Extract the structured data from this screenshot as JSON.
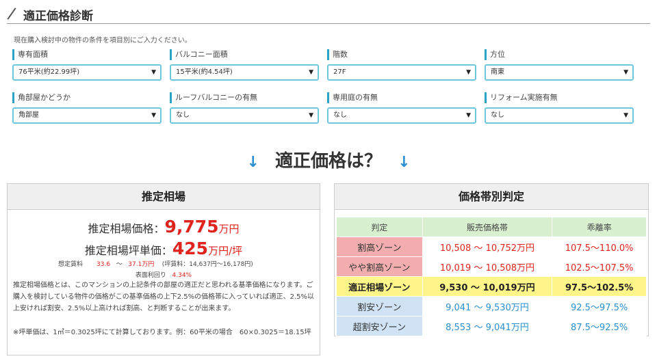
{
  "title": "適正価格診断",
  "intro": "現在購入検討中の物件の条件を項目別にご入力ください。",
  "fields": [
    {
      "label": "専有面積",
      "value": "76平米(約22.99坪)"
    },
    {
      "label": "バルコニー面積",
      "value": "15平米(約4.54坪)"
    },
    {
      "label": "階数",
      "value": "27F"
    },
    {
      "label": "方位",
      "value": "南東"
    },
    {
      "label": "角部屋かどうか",
      "value": "角部屋"
    },
    {
      "label": "ルーフバルコニーの有無",
      "value": "なし"
    },
    {
      "label": "専用庭の有無",
      "value": "なし"
    },
    {
      "label": "リフォーム実施有無",
      "value": "なし"
    }
  ],
  "question": "適正価格は？",
  "arrow": "↓",
  "caret": "▼",
  "estimate": {
    "heading": "推定相場",
    "price_label": "推定相場価格：",
    "price_value": "9,775",
    "price_unit": "万円",
    "tsubo_label": "推定相場坪単価：",
    "tsubo_value": "425",
    "tsubo_unit": "万円/坪",
    "rent_label": "想定賃料",
    "rent_min": "33.6",
    "rent_sep": "〜",
    "rent_max": "37.1万円",
    "rent_tsubo": "(坪賃料：14,637円〜16,178円)",
    "yield_label": "表面利回り",
    "yield_value": "4.34%",
    "description": "推定相場価格とは、このマンションの上記条件の部屋の適正だと思われる基準価格になります。ご購入を検討している物件の価格がこの基準価格の上下2.5%の価格帯に入っていれば適正、2.5%以上安ければ割安、2.5%以上高ければ割高、と判断することが出来ます。",
    "note": "※坪単価は、1㎡＝0.3025坪にて計算しております。例：60平米の場合　60×0.3025＝18.15坪"
  },
  "judge": {
    "heading": "価格帯別判定",
    "columns": [
      "判定",
      "販売価格帯",
      "乖離率"
    ],
    "rows": [
      {
        "zone": "割高ゾーン",
        "range": "10,508 〜 10,752万円",
        "rate": "107.5〜110.0%"
      },
      {
        "zone": "やや割高ゾーン",
        "range": "10,019 〜 10,508万円",
        "rate": "102.5〜107.5%"
      },
      {
        "zone": "適正相場ゾーン",
        "range": "9,530 〜 10,019万円",
        "rate": "97.5〜102.5%"
      },
      {
        "zone": "割安ゾーン",
        "range": "9,041 〜 9,530万円",
        "rate": "92.5〜97.5%"
      },
      {
        "zone": "超割安ゾーン",
        "range": "8,553 〜 9,041万円",
        "rate": "87.5〜92.5%"
      }
    ]
  },
  "colors": {
    "accent": "#2aa3c7",
    "price_red": "#e0231d",
    "cheap_blue": "#2a8fd0",
    "fair_yellow": "#fff68a",
    "high_pink": "#f2aeae",
    "low_blue": "#cfe3f4",
    "header_green": "#d8f0cf"
  }
}
